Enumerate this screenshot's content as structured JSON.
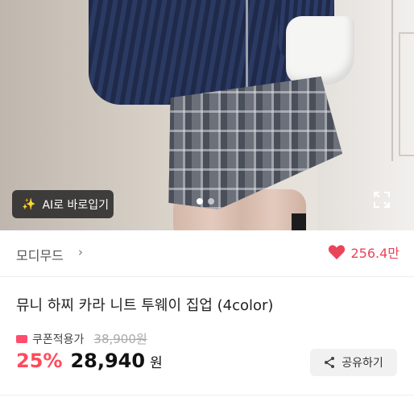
{
  "hero": {
    "ai_badge_label": "AI로 바로입기",
    "carousel": {
      "total": 2,
      "active_index": 0
    }
  },
  "brand": {
    "name": "모디무드",
    "chevron": "›"
  },
  "likes": {
    "count": "256.4만",
    "color": "#e8455b"
  },
  "product": {
    "title": "뮤니 하찌 카라 니트 투웨이 집업 (4color)",
    "coupon_label": "쿠폰적용가",
    "original_price": "38,900원",
    "discount": "25%",
    "price": "28,940",
    "currency": "원"
  },
  "actions": {
    "share_label": "공유하기"
  },
  "colors": {
    "accent": "#ff4a5b"
  }
}
